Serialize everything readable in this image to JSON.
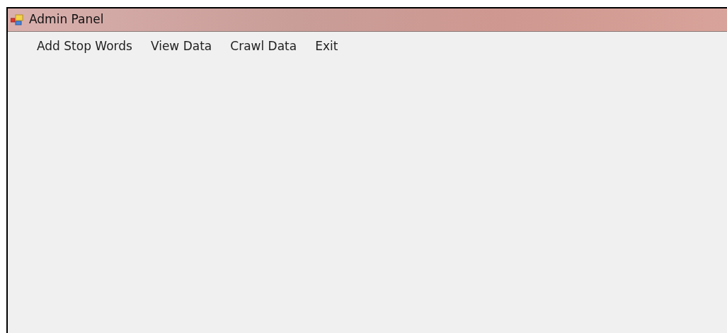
{
  "window": {
    "title": "Admin Panel"
  },
  "menu": [
    {
      "label": "Add Stop Words"
    },
    {
      "label": "View Data"
    },
    {
      "label": "Crawl Data"
    },
    {
      "label": "Exit"
    }
  ]
}
